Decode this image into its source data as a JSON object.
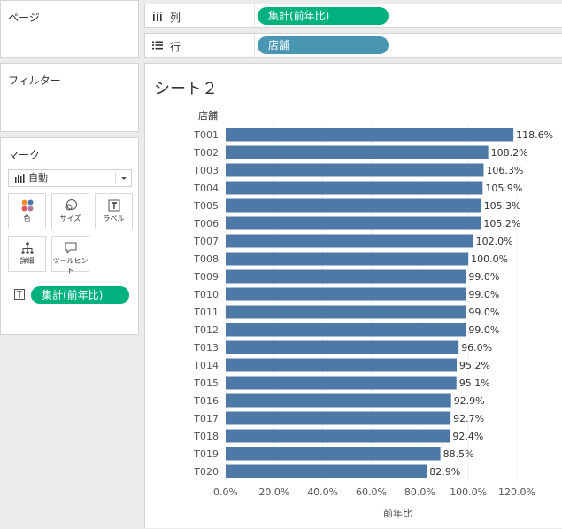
{
  "panels": {
    "pages_title": "ページ",
    "filters_title": "フィルター",
    "marks_title": "マーク",
    "marks_type": "自動",
    "mark_buttons": [
      {
        "label": "色",
        "icon": "color-icon"
      },
      {
        "label": "サイズ",
        "icon": "size-icon"
      },
      {
        "label": "ラベル",
        "icon": "label-icon"
      },
      {
        "label": "詳細",
        "icon": "detail-icon"
      },
      {
        "label": "ツールヒント",
        "icon": "tooltip-icon"
      }
    ],
    "label_pill": "集計(前年比)"
  },
  "shelves": {
    "columns_label": "列",
    "columns_pill": "集計(前年比)",
    "rows_label": "行",
    "rows_pill": "店舗"
  },
  "colors": {
    "measure_pill": "#00b180",
    "dimension_pill": "#4996b2",
    "bar": "#4e79a7"
  },
  "sheet_title": "シート２",
  "chart_data": {
    "type": "bar",
    "orientation": "horizontal",
    "row_header": "店舗",
    "categories": [
      "T001",
      "T002",
      "T003",
      "T004",
      "T005",
      "T006",
      "T007",
      "T008",
      "T009",
      "T010",
      "T011",
      "T012",
      "T013",
      "T014",
      "T015",
      "T016",
      "T017",
      "T018",
      "T019",
      "T020"
    ],
    "values": [
      118.6,
      108.2,
      106.3,
      105.9,
      105.3,
      105.2,
      102.0,
      100.0,
      99.0,
      99.0,
      99.0,
      99.0,
      96.0,
      95.2,
      95.1,
      92.9,
      92.7,
      92.4,
      88.5,
      82.9
    ],
    "value_labels": [
      "118.6%",
      "108.2%",
      "106.3%",
      "105.9%",
      "105.3%",
      "105.2%",
      "102.0%",
      "100.0%",
      "99.0%",
      "99.0%",
      "99.0%",
      "99.0%",
      "96.0%",
      "95.2%",
      "95.1%",
      "92.9%",
      "92.7%",
      "92.4%",
      "88.5%",
      "82.9%"
    ],
    "xticks": [
      "0.0%",
      "20.0%",
      "40.0%",
      "60.0%",
      "80.0%",
      "100.0%",
      "120.0%"
    ],
    "xtick_values": [
      0,
      20,
      40,
      60,
      80,
      100,
      120
    ],
    "xlabel": "前年比",
    "xlim": [
      0,
      120
    ],
    "grid": true
  }
}
